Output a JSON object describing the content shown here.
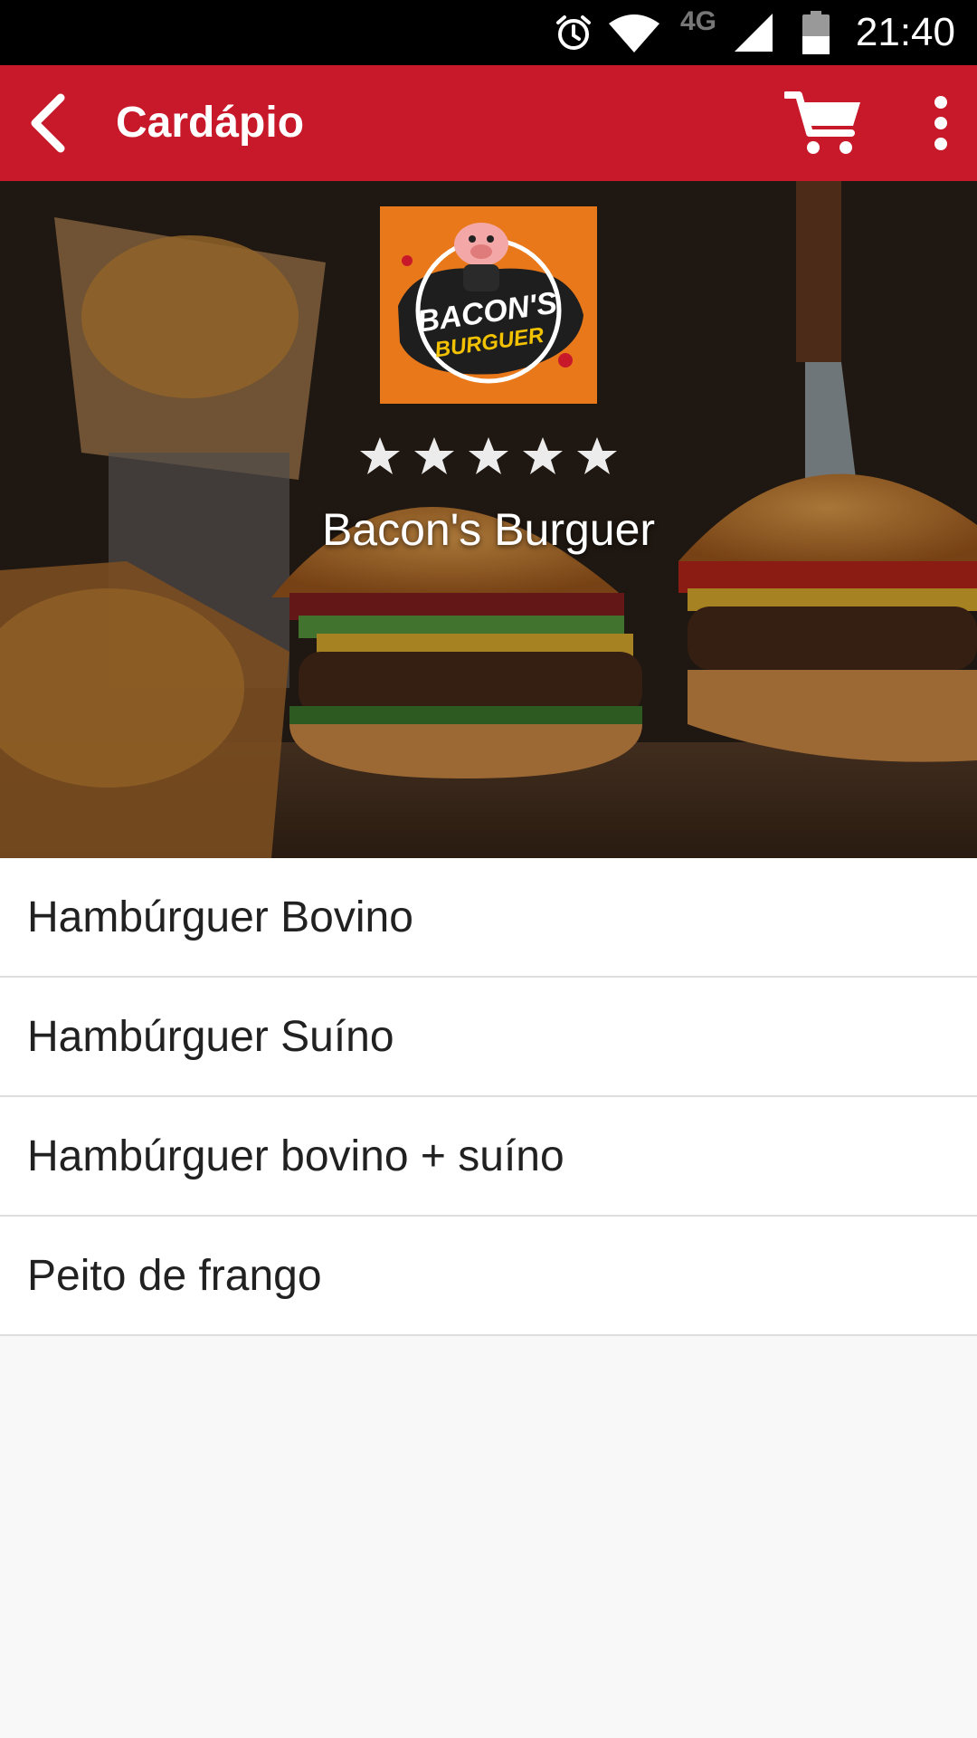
{
  "status_bar": {
    "time": "21:40",
    "network": "4G",
    "icons": [
      "alarm-icon",
      "wifi-icon",
      "signal-icon",
      "battery-icon"
    ]
  },
  "app_bar": {
    "title": "Cardápio",
    "color": "#c8192a",
    "icons": [
      "back-arrow-icon",
      "cart-icon",
      "more-vert-icon"
    ]
  },
  "restaurant": {
    "name": "Bacon's Burguer",
    "logo_text_top": "BACON'S",
    "logo_text_bottom": "BURGUER",
    "rating": 5,
    "rating_max": 5
  },
  "categories": [
    {
      "label": "Hambúrguer Bovino"
    },
    {
      "label": "Hambúrguer Suíno"
    },
    {
      "label": "Hambúrguer bovino + suíno"
    },
    {
      "label": "Peito de frango"
    }
  ]
}
